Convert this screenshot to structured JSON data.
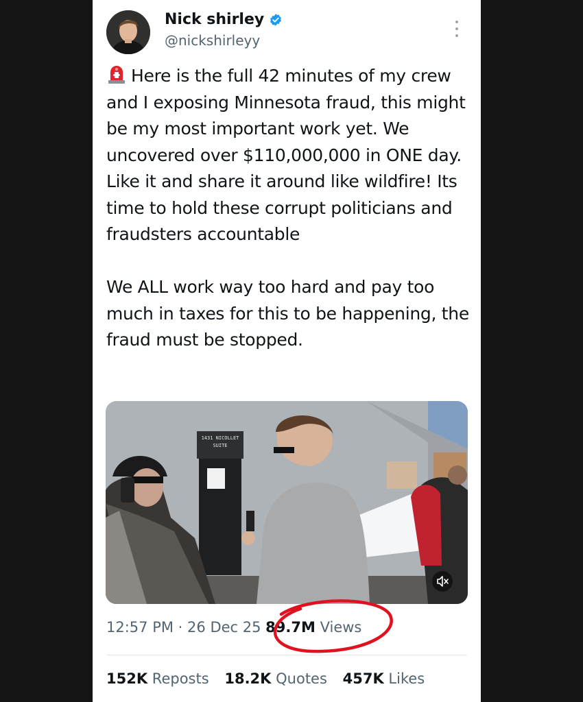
{
  "author": {
    "name": "Nick shirley",
    "handle": "@nickshirleyy",
    "verified_color": "#1d9bf0"
  },
  "post": {
    "text": "Here is the full 42 minutes of my crew and I exposing Minnesota fraud, this might be my most important work yet. We uncovered over $110,000,000 in ONE day. Like it and share it around like wildfire! Its time to hold these corrupt politicians and fraudsters accountable\n\nWe ALL work way too hard and pay too much in taxes for this to be happening, the fraud must be stopped.",
    "leading_emoji": "rotating-light-icon"
  },
  "media": {
    "type": "video",
    "sign_line1": "1431 NICOLLET",
    "sign_line2": "SUITE",
    "mute_icon": "speaker-muted-icon"
  },
  "meta": {
    "time": "12:57 PM",
    "separator": "·",
    "date": "26 Dec 25",
    "views_count": "89.7M",
    "views_label": "Views",
    "highlight_color": "#e0121f"
  },
  "stats": {
    "reposts_count": "152K",
    "reposts_label": "Reposts",
    "quotes_count": "18.2K",
    "quotes_label": "Quotes",
    "likes_count": "457K",
    "likes_label": "Likes"
  }
}
